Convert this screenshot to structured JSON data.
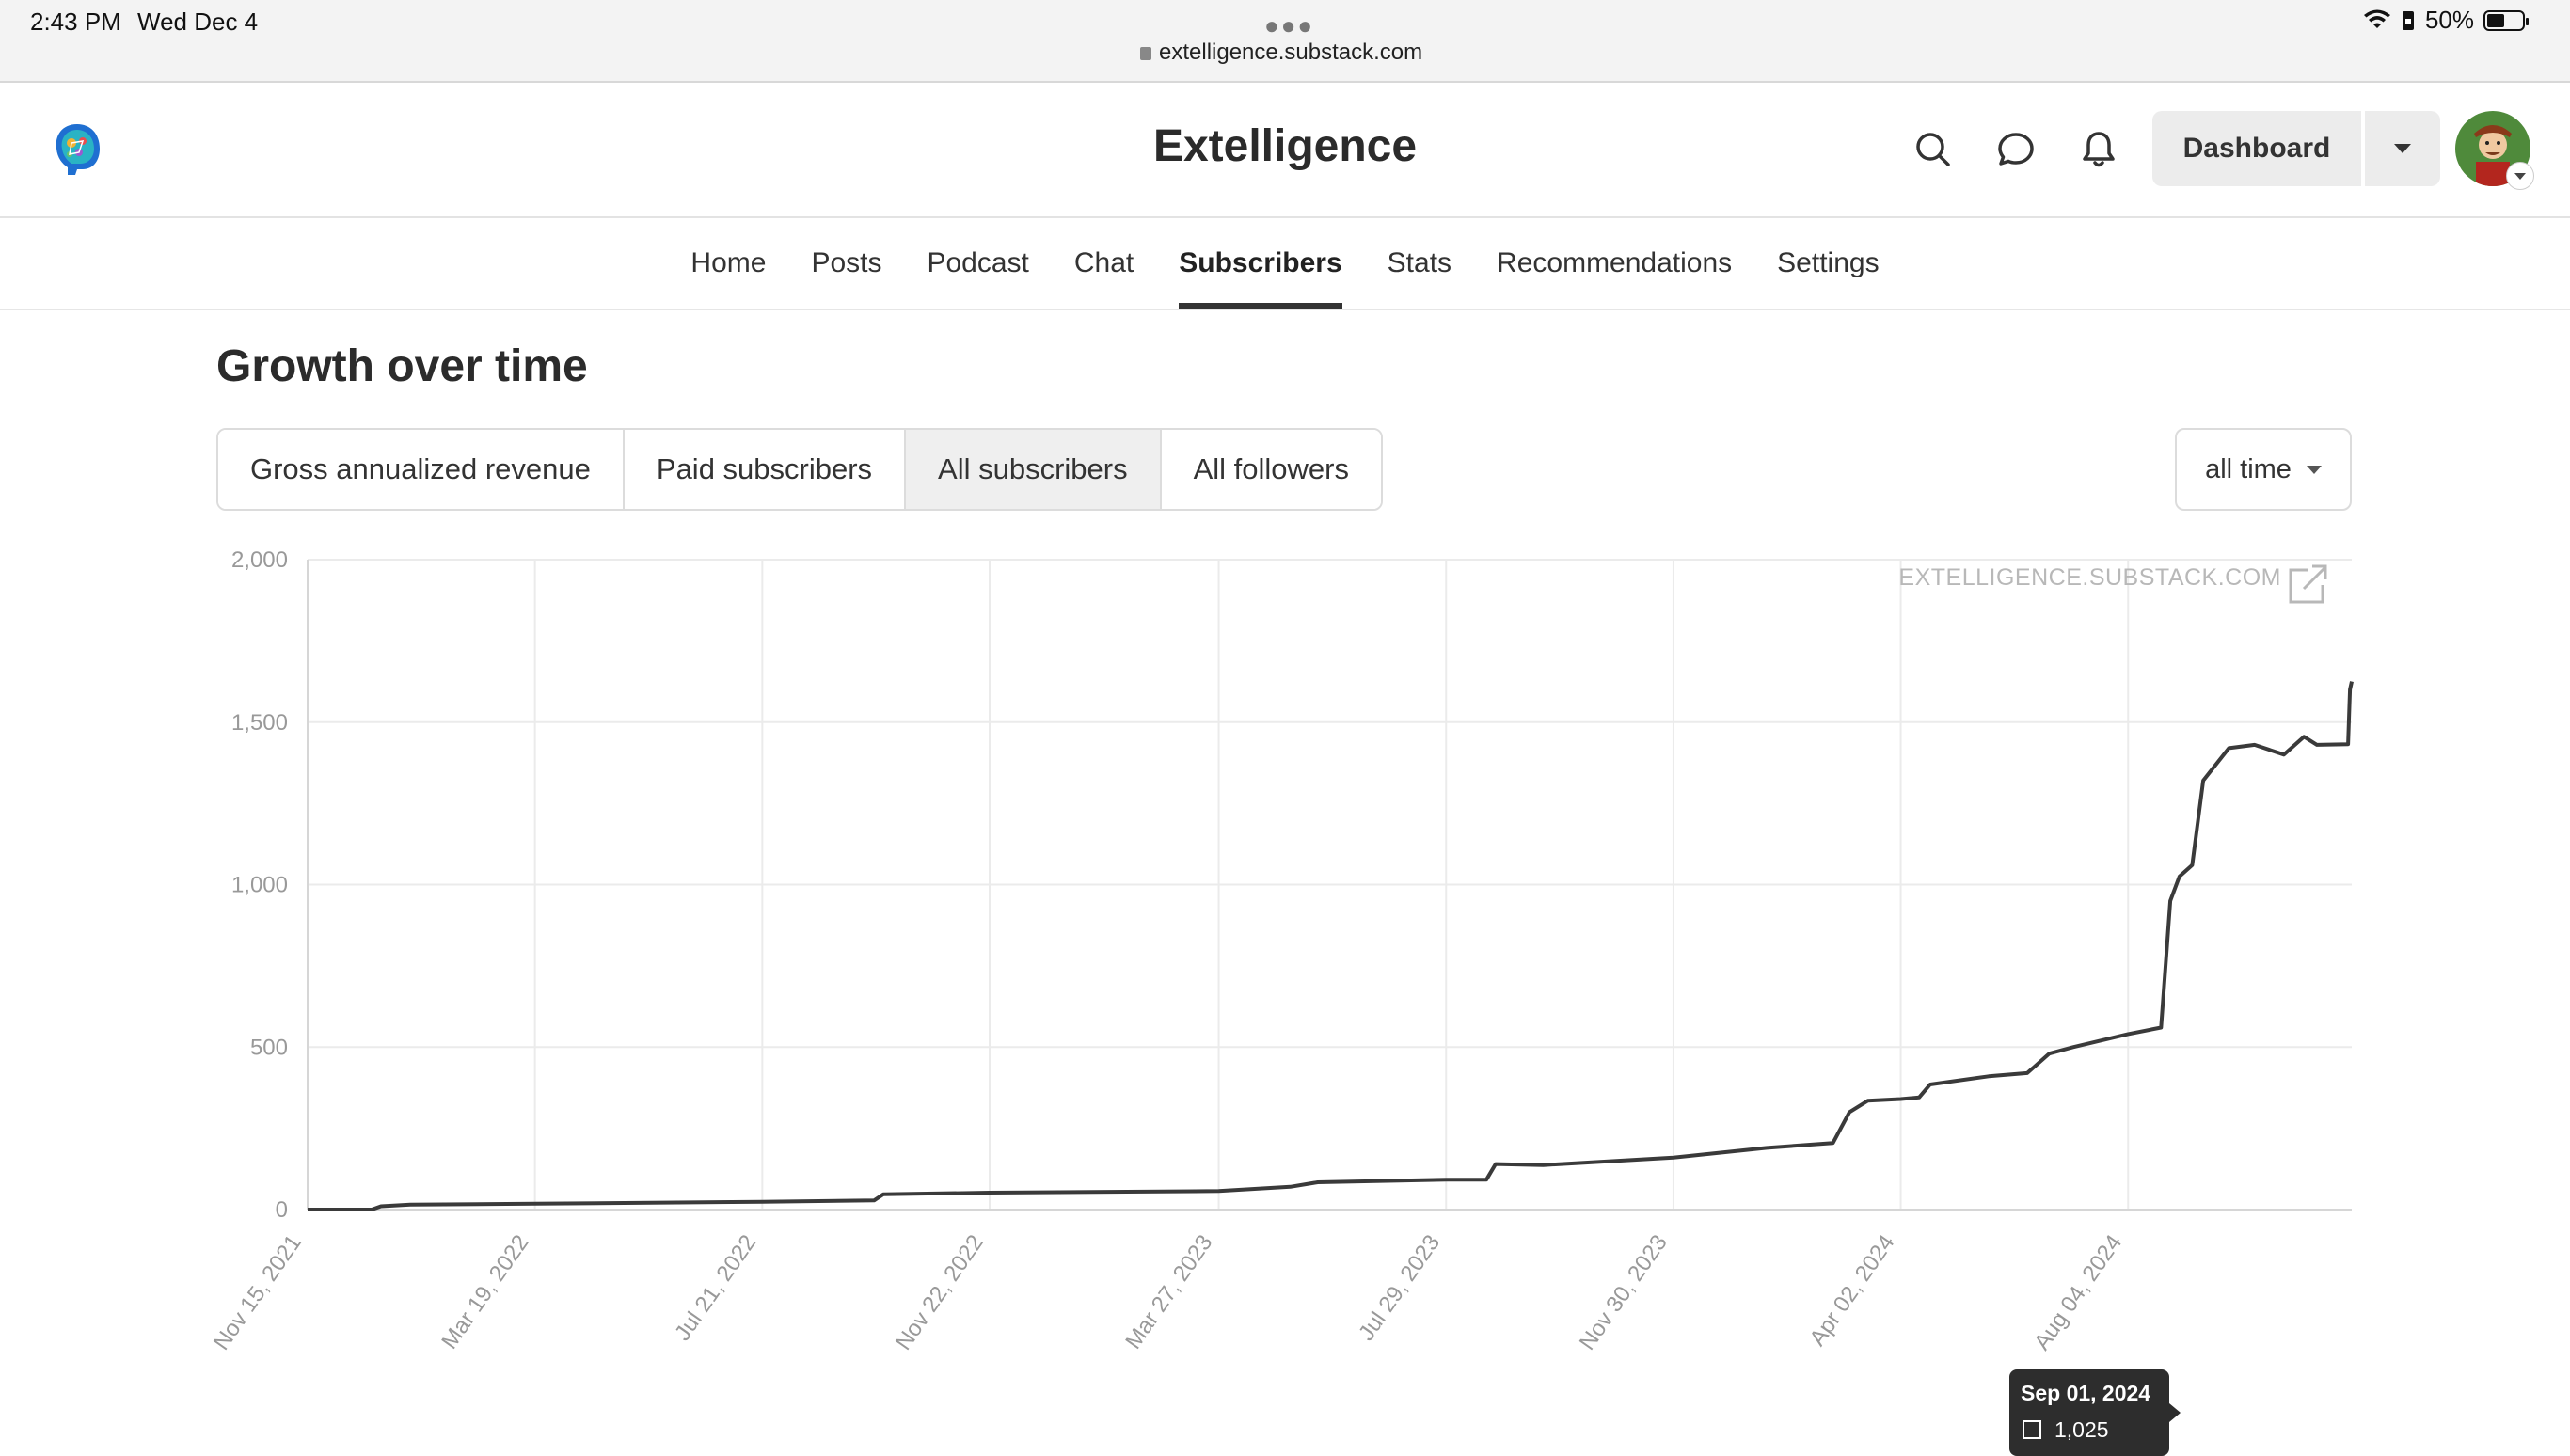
{
  "status_bar": {
    "time": "2:43 PM",
    "date": "Wed Dec 4",
    "url": "extelligence.substack.com",
    "battery": "50%",
    "battery_level": 0.5
  },
  "header": {
    "title": "Extelligence",
    "dashboard_label": "Dashboard",
    "icons": [
      "search-icon",
      "chat-bubble-icon",
      "bell-icon",
      "chevron-down-icon"
    ]
  },
  "nav": {
    "tabs": [
      {
        "label": "Home",
        "active": false
      },
      {
        "label": "Posts",
        "active": false
      },
      {
        "label": "Podcast",
        "active": false
      },
      {
        "label": "Chat",
        "active": false
      },
      {
        "label": "Subscribers",
        "active": true
      },
      {
        "label": "Stats",
        "active": false
      },
      {
        "label": "Recommendations",
        "active": false
      },
      {
        "label": "Settings",
        "active": false
      }
    ]
  },
  "section": {
    "title": "Growth over time",
    "metric_tabs": [
      {
        "label": "Gross annualized revenue",
        "active": false
      },
      {
        "label": "Paid subscribers",
        "active": false
      },
      {
        "label": "All subscribers",
        "active": true
      },
      {
        "label": "All followers",
        "active": false
      }
    ],
    "range_value": "all time"
  },
  "tooltip": {
    "date": "Sep 01, 2024",
    "value": "1,025"
  },
  "colors": {
    "line": "#3a3a3a",
    "grid": "#ebebeb",
    "tooltip_bg": "#2d2d2d"
  },
  "chart_data": {
    "type": "line",
    "title": "",
    "xlabel": "",
    "ylabel": "",
    "watermark": "EXTELLIGENCE.SUBSTACK.COM",
    "ylim": [
      0,
      2000
    ],
    "y_ticks": [
      "0",
      "500",
      "1,000",
      "1,500",
      "2,000"
    ],
    "x_ticks": [
      "Nov 15, 2021",
      "Mar 19, 2022",
      "Jul 21, 2022",
      "Nov 22, 2022",
      "Mar 27, 2023",
      "Jul 29, 2023",
      "Nov 30, 2023",
      "Apr 02, 2024",
      "Aug 04, 2024"
    ],
    "grid": true,
    "series": [
      {
        "values": [
          [
            "2021-11-15",
            0
          ],
          [
            "2021-12-20",
            0
          ],
          [
            "2021-12-25",
            10
          ],
          [
            "2022-01-10",
            15
          ],
          [
            "2022-03-19",
            18
          ],
          [
            "2022-07-21",
            24
          ],
          [
            "2022-09-20",
            28
          ],
          [
            "2022-09-25",
            47
          ],
          [
            "2022-11-22",
            52
          ],
          [
            "2023-03-27",
            57
          ],
          [
            "2023-05-05",
            70
          ],
          [
            "2023-05-20",
            84
          ],
          [
            "2023-07-29",
            92
          ],
          [
            "2023-08-20",
            92
          ],
          [
            "2023-08-25",
            140
          ],
          [
            "2023-09-20",
            137
          ],
          [
            "2023-11-30",
            160
          ],
          [
            "2024-01-20",
            190
          ],
          [
            "2024-02-25",
            205
          ],
          [
            "2024-03-05",
            300
          ],
          [
            "2024-03-15",
            335
          ],
          [
            "2024-04-02",
            340
          ],
          [
            "2024-04-12",
            345
          ],
          [
            "2024-04-18",
            385
          ],
          [
            "2024-05-20",
            410
          ],
          [
            "2024-06-10",
            420
          ],
          [
            "2024-06-22",
            480
          ],
          [
            "2024-07-05",
            500
          ],
          [
            "2024-08-04",
            540
          ],
          [
            "2024-08-22",
            560
          ],
          [
            "2024-08-27",
            950
          ],
          [
            "2024-09-01",
            1025
          ],
          [
            "2024-09-08",
            1060
          ],
          [
            "2024-09-14",
            1320
          ],
          [
            "2024-09-28",
            1420
          ],
          [
            "2024-10-12",
            1430
          ],
          [
            "2024-10-28",
            1400
          ],
          [
            "2024-11-08",
            1455
          ],
          [
            "2024-11-15",
            1430
          ],
          [
            "2024-12-02",
            1432
          ],
          [
            "2024-12-03",
            1600
          ],
          [
            "2024-12-04",
            1625
          ]
        ]
      }
    ],
    "tooltip_point": [
      "2024-09-01",
      1025
    ]
  }
}
